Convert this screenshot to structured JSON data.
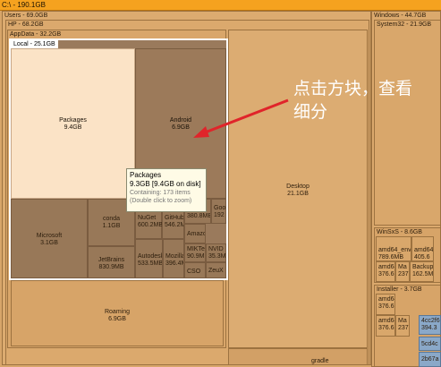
{
  "root": {
    "label": "C:\\ - 190.1GB"
  },
  "users": {
    "label": "Users - 69.0GB"
  },
  "hp": {
    "label": "HP - 68.2GB"
  },
  "appdata": {
    "label": "AppData - 32.2GB"
  },
  "local": {
    "label": "Local - 25.1GB"
  },
  "packages": {
    "name": "Packages",
    "size": "9.4GB"
  },
  "android": {
    "name": "Android",
    "size": "6.9GB"
  },
  "microsoft": {
    "name": "Microsoft",
    "size": "3.1GB"
  },
  "conda": {
    "name": "conda",
    "size": "1.1GB"
  },
  "jetbrains": {
    "name": "JetBrains",
    "size": "830.9MB"
  },
  "nuget": {
    "name": "NuGet",
    "size": "600.2MB"
  },
  "github": {
    "name": "GitHub",
    "size": "546.2M"
  },
  "autodesk": {
    "name": "Autodesk",
    "size": "533.5MB"
  },
  "mozilla": {
    "name": "Mozilla",
    "size": "396.4M"
  },
  "amazon": {
    "name": "Amazo"
  },
  "cell_380": {
    "name": "",
    "size": "380.8MB"
  },
  "goo": {
    "name": "Goo",
    "size": "192"
  },
  "mikt": {
    "name": "MIKTe",
    "size": "90.9M"
  },
  "nvid": {
    "name": "NVID",
    "size": "35.3M"
  },
  "cso": {
    "name": "CSO"
  },
  "zeux": {
    "name": "ZeuX"
  },
  "desktop": {
    "name": "Desktop",
    "size": "21.1GB"
  },
  "roaming": {
    "name": "Roaming",
    "size": "6.9GB"
  },
  "windows": {
    "label": "Windows - 44.7GB"
  },
  "system32": {
    "label": "System32 - 21.9GB"
  },
  "winsxs": {
    "label": "WinSxS - 8.6GB"
  },
  "installer": {
    "label": "Installer - 3.7GB"
  },
  "w_amd64_env": {
    "name": "amd64_env",
    "size": "789.6MB"
  },
  "w_amd64_b": {
    "name": "amd64",
    "size": "405.6"
  },
  "w_amd64_c": {
    "name": "amd64",
    "size": "376.6"
  },
  "w_ma": {
    "name": "Ma",
    "size": "237"
  },
  "w_backup": {
    "name": "Backup",
    "size": "162.5M"
  },
  "w_amd64_d": {
    "name": "amd64",
    "size": "376.6"
  },
  "w_amd64_e": {
    "name": "amd64",
    "size": "376.6"
  },
  "w_ma2": {
    "name": "Ma",
    "size": "237"
  },
  "w_4cc2f6": {
    "name": "4cc2f6",
    "size": "394.3"
  },
  "w_5cd4c": {
    "name": "5cd4c"
  },
  "w_2b67a": {
    "name": "2b67a"
  },
  "gradle": {
    "label": "gradle"
  },
  "tooltip": {
    "title": "Packages",
    "size": "9.3GB [9.4GB on disk]",
    "containing": "Containing: 173 items",
    "hint": "(Double click to zoom)"
  },
  "annotation": {
    "line1": "点击方块，查看",
    "line2": "细分"
  },
  "colors": {
    "base": "#d8a66a",
    "selected": "#9c7a5a",
    "highlight": "#fbe3c6",
    "root_bar": "#f5a21f",
    "arrow": "#e0242a"
  }
}
